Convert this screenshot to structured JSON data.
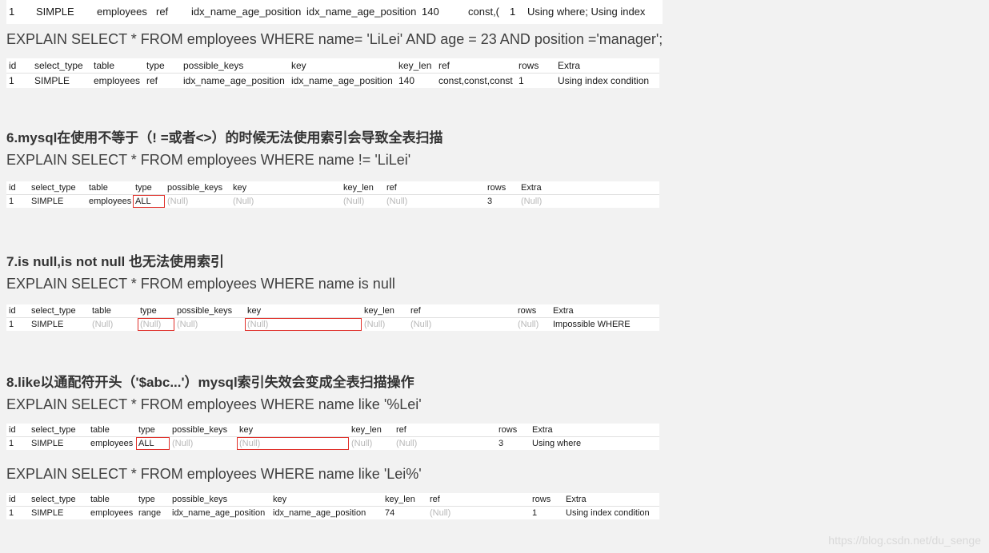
{
  "top_table": {
    "row": [
      "1",
      "SIMPLE",
      "employees",
      "ref",
      "idx_name_age_position",
      "idx_name_age_position",
      "140",
      "const,(",
      "1",
      "Using where; Using index"
    ]
  },
  "sections": [
    {
      "sql": "EXPLAIN SELECT * FROM employees WHERE name= 'LiLei' AND age = 23 AND position ='manager';",
      "headers": [
        "id",
        "select_type",
        "table",
        "type",
        "possible_keys",
        "key",
        "key_len",
        "ref",
        "rows",
        "Extra"
      ],
      "row": [
        "1",
        "SIMPLE",
        "employees",
        "ref",
        "idx_name_age_position",
        "idx_name_age_position",
        "140",
        "const,const,const",
        "1",
        "Using index condition"
      ]
    },
    {
      "heading": "6.mysql在使用不等于（! =或者<>）的时候无法使用索引会导致全表扫描",
      "sql": "EXPLAIN SELECT * FROM employees WHERE name != 'LiLei'",
      "headers": [
        "id",
        "select_type",
        "table",
        "type",
        "possible_keys",
        "key",
        "key_len",
        "ref",
        "rows",
        "Extra"
      ],
      "row": [
        "1",
        "SIMPLE",
        "employees",
        "ALL",
        "(Null)",
        "(Null)",
        "(Null)",
        "(Null)",
        "3",
        "(Null)"
      ]
    },
    {
      "heading": "7.is null,is not null 也无法使用索引",
      "sql": "EXPLAIN SELECT * FROM employees WHERE name is null",
      "headers": [
        "id",
        "select_type",
        "table",
        "type",
        "possible_keys",
        "key",
        "key_len",
        "ref",
        "rows",
        "Extra"
      ],
      "row": [
        "1",
        "SIMPLE",
        "(Null)",
        "(Null)",
        "(Null)",
        "(Null)",
        "(Null)",
        "(Null)",
        "(Null)",
        "Impossible WHERE"
      ]
    },
    {
      "heading": "8.like以通配符开头（'$abc...'）mysql索引失效会变成全表扫描操作",
      "sql": "EXPLAIN SELECT * FROM employees WHERE name like '%Lei'",
      "headers": [
        "id",
        "select_type",
        "table",
        "type",
        "possible_keys",
        "key",
        "key_len",
        "ref",
        "rows",
        "Extra"
      ],
      "row": [
        "1",
        "SIMPLE",
        "employees",
        "ALL",
        "(Null)",
        "(Null)",
        "(Null)",
        "(Null)",
        "3",
        "Using where"
      ]
    },
    {
      "sql": "EXPLAIN SELECT * FROM employees WHERE name like 'Lei%'",
      "headers": [
        "id",
        "select_type",
        "table",
        "type",
        "possible_keys",
        "key",
        "key_len",
        "ref",
        "rows",
        "Extra"
      ],
      "row": [
        "1",
        "SIMPLE",
        "employees",
        "range",
        "idx_name_age_position",
        "idx_name_age_position",
        "74",
        "(Null)",
        "1",
        "Using index condition"
      ]
    }
  ],
  "watermark": "https://blog.csdn.net/du_senge",
  "colors": {
    "highlight_box": "#e0302a",
    "null_text": "#b8b8b8",
    "page_bg": "#f2f2f2"
  }
}
